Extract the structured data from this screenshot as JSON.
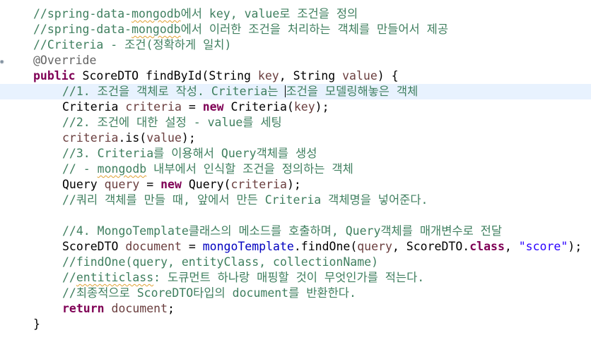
{
  "editor": {
    "lines": [
      {
        "indent": 1,
        "tokens": [
          [
            "cmt",
            "//spring-data-"
          ],
          [
            "cmt squig",
            "mongodb"
          ],
          [
            "cmt",
            "에서 key, value로 조건을 정의"
          ]
        ]
      },
      {
        "indent": 1,
        "tokens": [
          [
            "cmt",
            "//spring-data-"
          ],
          [
            "cmt squig",
            "mongodb"
          ],
          [
            "cmt",
            "에서 이러한 조건을 처리하는 객체를 만들어서 제공"
          ]
        ]
      },
      {
        "indent": 1,
        "tokens": [
          [
            "cmt",
            "//Criteria - 조건(정확하게 일치)"
          ]
        ]
      },
      {
        "indent": 1,
        "tokens": [
          [
            "ann",
            "@Override"
          ]
        ]
      },
      {
        "indent": 1,
        "tokens": [
          [
            "kw",
            "public"
          ],
          [
            "pln",
            " ScoreDTO findById(String "
          ],
          [
            "var",
            "key"
          ],
          [
            "pln",
            ", String "
          ],
          [
            "var",
            "value"
          ],
          [
            "pln",
            ") {"
          ]
        ]
      },
      {
        "indent": 2,
        "current": true,
        "tokens": [
          [
            "cmt",
            "//1. 조건을 객체로 작성. Criteria는 "
          ],
          [
            "caret",
            ""
          ],
          [
            "cmt",
            "조건을 모델링해놓은 객체"
          ]
        ]
      },
      {
        "indent": 2,
        "tokens": [
          [
            "pln",
            "Criteria "
          ],
          [
            "var",
            "criteria"
          ],
          [
            "pln",
            " = "
          ],
          [
            "kw",
            "new"
          ],
          [
            "pln",
            " Criteria("
          ],
          [
            "var",
            "key"
          ],
          [
            "pln",
            ");"
          ]
        ]
      },
      {
        "indent": 2,
        "tokens": [
          [
            "cmt",
            "//2. 조건에 대한 설정 - value를 세팅"
          ]
        ]
      },
      {
        "indent": 2,
        "tokens": [
          [
            "var",
            "criteria"
          ],
          [
            "pln",
            ".is("
          ],
          [
            "var",
            "value"
          ],
          [
            "pln",
            ");"
          ]
        ]
      },
      {
        "indent": 2,
        "tokens": [
          [
            "cmt",
            "//3. Criteria를 이용해서 Query객체를 생성"
          ]
        ]
      },
      {
        "indent": 2,
        "tokens": [
          [
            "cmt",
            "// - "
          ],
          [
            "cmt squig",
            "mongodb"
          ],
          [
            "cmt",
            " 내부에서 인식할 조건을 정의하는 객체"
          ]
        ]
      },
      {
        "indent": 2,
        "tokens": [
          [
            "pln",
            "Query "
          ],
          [
            "var",
            "query"
          ],
          [
            "pln",
            " = "
          ],
          [
            "kw",
            "new"
          ],
          [
            "pln",
            " Query("
          ],
          [
            "var",
            "criteria"
          ],
          [
            "pln",
            ");"
          ]
        ]
      },
      {
        "indent": 2,
        "tokens": [
          [
            "cmt",
            "//쿼리 객체를 만들 때, 앞에서 만든 Criteria 객체명을 넣어준다."
          ]
        ]
      },
      {
        "indent": 2,
        "tokens": []
      },
      {
        "indent": 2,
        "tokens": [
          [
            "cmt",
            "//4. MongoTemplate클래스의 메소드를 호출하며, Query객체를 매개변수로 전달"
          ]
        ]
      },
      {
        "indent": 2,
        "tokens": [
          [
            "pln",
            "ScoreDTO "
          ],
          [
            "var",
            "document"
          ],
          [
            "pln",
            " = "
          ],
          [
            "fld",
            "mongoTemplate"
          ],
          [
            "pln",
            ".findOne("
          ],
          [
            "var",
            "query"
          ],
          [
            "pln",
            ", ScoreDTO."
          ],
          [
            "kw",
            "class"
          ],
          [
            "pln",
            ", "
          ],
          [
            "str",
            "\"score\""
          ],
          [
            "pln",
            ");"
          ]
        ]
      },
      {
        "indent": 2,
        "tokens": [
          [
            "cmt",
            "//findOne(query, entityClass, collectionName)"
          ]
        ]
      },
      {
        "indent": 2,
        "tokens": [
          [
            "cmt",
            "//"
          ],
          [
            "cmt squig",
            "entiticlass"
          ],
          [
            "cmt",
            ": 도큐먼트 하나랑 매핑할 것이 무엇인가를 적는다."
          ]
        ]
      },
      {
        "indent": 2,
        "tokens": [
          [
            "cmt",
            "//최종적으로 ScoreDTO타입의 document를 반환한다."
          ]
        ]
      },
      {
        "indent": 2,
        "tokens": [
          [
            "kw",
            "return"
          ],
          [
            "pln",
            " "
          ],
          [
            "var",
            "document"
          ],
          [
            "pln",
            ";"
          ]
        ]
      },
      {
        "indent": 1,
        "tokens": [
          [
            "pln",
            "}"
          ]
        ]
      }
    ]
  }
}
